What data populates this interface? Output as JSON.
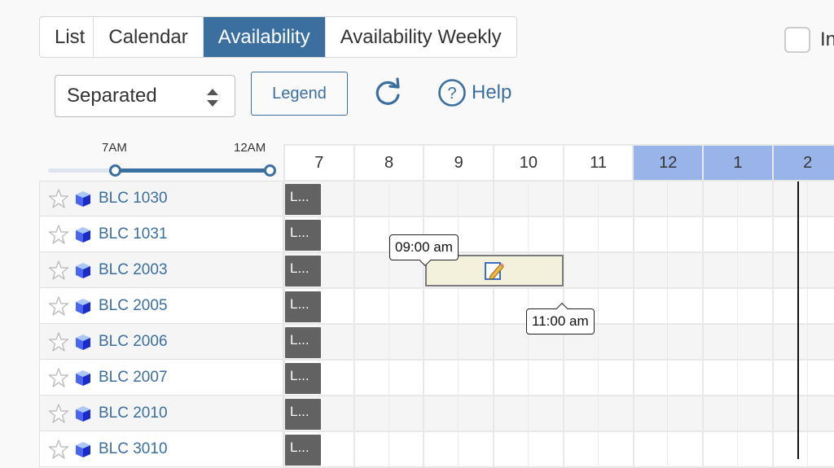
{
  "tabs": [
    {
      "label": "List",
      "active": false
    },
    {
      "label": "Calendar",
      "active": false
    },
    {
      "label": "Availability",
      "active": true
    },
    {
      "label": "Availability Weekly",
      "active": false
    }
  ],
  "checkbox": {
    "label": "In",
    "checked": false
  },
  "toolbar": {
    "view_select": {
      "value": "Separated"
    },
    "legend_label": "Legend",
    "refresh_icon": "refresh-icon",
    "help_label": "Help",
    "help_icon": "question-circle-icon"
  },
  "time_range": {
    "start_label": "7AM",
    "end_label": "12AM",
    "start_fraction": 0.3,
    "end_fraction": 1.0
  },
  "hours": [
    {
      "label": "7",
      "pm": false
    },
    {
      "label": "8",
      "pm": false
    },
    {
      "label": "9",
      "pm": false
    },
    {
      "label": "10",
      "pm": false
    },
    {
      "label": "11",
      "pm": false
    },
    {
      "label": "12",
      "pm": true
    },
    {
      "label": "1",
      "pm": true
    },
    {
      "label": "2",
      "pm": true
    }
  ],
  "rooms": [
    {
      "name": "BLC 1030",
      "badge": "L..."
    },
    {
      "name": "BLC 1031",
      "badge": "L..."
    },
    {
      "name": "BLC 2003",
      "badge": "L..."
    },
    {
      "name": "BLC 2005",
      "badge": "L..."
    },
    {
      "name": "BLC 2006",
      "badge": "L..."
    },
    {
      "name": "BLC 2007",
      "badge": "L..."
    },
    {
      "name": "BLC 2010",
      "badge": "L..."
    },
    {
      "name": "BLC 3010",
      "badge": "L..."
    }
  ],
  "booking": {
    "room": "BLC 2003",
    "start_label": "09:00 am",
    "end_label": "11:00 am",
    "icon": "edit-pencil-icon"
  },
  "colors": {
    "accent": "#3b6f9f",
    "pm_header": "#98b4e8",
    "booking_fill": "#f3f1dc",
    "badge": "#626262"
  }
}
